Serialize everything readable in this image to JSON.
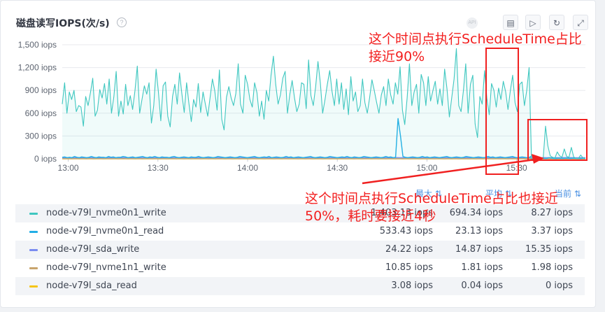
{
  "panel": {
    "title": "磁盘读写IOPS(次/s)",
    "help_icon": "?",
    "api_icon": "API",
    "toolbar": [
      {
        "name": "calendar-icon",
        "glyph": "▤"
      },
      {
        "name": "play-icon",
        "glyph": "▷"
      },
      {
        "name": "refresh-icon",
        "glyph": "↻"
      },
      {
        "name": "expand-icon",
        "glyph": "⤢"
      }
    ]
  },
  "legend": {
    "headers": {
      "max": "最大",
      "avg": "平均",
      "current": "当前"
    },
    "rows": [
      {
        "name": "node-v79l_nvme0n1_write",
        "color": "#3fc7c0",
        "max": "1,403.13 iops",
        "avg": "694.34 iops",
        "current": "8.27 iops"
      },
      {
        "name": "node-v79l_nvme0n1_read",
        "color": "#22aee6",
        "max": "533.43 iops",
        "avg": "23.13 iops",
        "current": "3.37 iops"
      },
      {
        "name": "node-v79l_sda_write",
        "color": "#7b8cf0",
        "max": "24.22 iops",
        "avg": "14.87 iops",
        "current": "15.35 iops"
      },
      {
        "name": "node-v79l_nvme1n1_write",
        "color": "#c8a46c",
        "max": "10.85 iops",
        "avg": "1.81 iops",
        "current": "1.98 iops"
      },
      {
        "name": "node-v79l_sda_read",
        "color": "#f5c518",
        "max": "3.08 iops",
        "avg": "0.04 iops",
        "current": "0 iops"
      }
    ]
  },
  "annotations": {
    "top": "这个时间点执行ScheduleTime占比接近90%",
    "bottom": "这个时间点执行ScheduleTime占比也接近50%，耗时要接近4秒"
  },
  "chart_data": {
    "type": "line",
    "x_ticks": [
      "13:00",
      "13:30",
      "14:00",
      "14:30",
      "15:00",
      "15:30"
    ],
    "x_range": [
      "12:58",
      "15:53"
    ],
    "ylim": [
      0,
      1500
    ],
    "y_ticks": [
      "0 iops",
      "300 iops",
      "600 iops",
      "900 iops",
      "1,200 iops",
      "1,500 iops"
    ],
    "grid": true,
    "series": [
      {
        "name": "node-v79l_nvme0n1_write",
        "color": "#3fc7c0",
        "area": true,
        "values": [
          720,
          1000,
          600,
          880,
          780,
          900,
          620,
          700,
          680,
          430,
          820,
          700,
          870,
          1060,
          560,
          640,
          910,
          800,
          990,
          720,
          1050,
          600,
          820,
          1150,
          560,
          760,
          590,
          980,
          700,
          830,
          650,
          900,
          1220,
          600,
          780,
          960,
          850,
          1000,
          470,
          700,
          1180,
          880,
          500,
          960,
          1010,
          560,
          420,
          820,
          980,
          720,
          1130,
          850,
          610,
          1000,
          730,
          490,
          780,
          680,
          990,
          610,
          880,
          720,
          560,
          800,
          1050,
          900,
          640,
          1170,
          520,
          380,
          810,
          950,
          800,
          700,
          860,
          1250,
          720,
          600,
          1100,
          980,
          780,
          680,
          1000,
          870,
          560,
          760,
          520,
          900,
          760,
          1100,
          1350,
          980,
          720,
          840,
          1060,
          1150,
          600,
          850,
          1030,
          800,
          620,
          720,
          1000,
          980,
          660,
          1300,
          830,
          700,
          950,
          1280,
          1000,
          600,
          780,
          980,
          1160,
          890,
          700,
          1050,
          720,
          1000,
          650,
          920,
          580,
          1080,
          760,
          880,
          620,
          700,
          1050,
          740,
          600,
          800,
          1040,
          900,
          740,
          600,
          840,
          950,
          700,
          1050,
          840,
          720,
          1000,
          850,
          1210,
          640,
          450,
          800,
          1250,
          700,
          880,
          980,
          600,
          1110,
          1000,
          700,
          1080,
          760,
          900,
          1020,
          720,
          920,
          700,
          1180,
          920,
          550,
          800,
          1050,
          1450,
          700,
          620,
          900,
          1250,
          600,
          980,
          1100,
          460,
          280,
          820,
          720,
          1160,
          800,
          580,
          990,
          900,
          680,
          930,
          780,
          1020,
          880,
          650,
          900,
          1100,
          740,
          620,
          980,
          1010,
          700,
          900,
          1200,
          0,
          0,
          0,
          0,
          0,
          0,
          430,
          170,
          40,
          20,
          10,
          90,
          40,
          20,
          130,
          30,
          20,
          150,
          25,
          5,
          5,
          50,
          10,
          8
        ]
      },
      {
        "name": "node-v79l_nvme0n1_read",
        "color": "#22aee6",
        "area": false,
        "values": [
          20,
          25,
          15,
          20,
          15,
          30,
          20,
          15,
          25,
          20,
          15,
          20,
          30,
          20,
          15,
          25,
          20,
          20,
          15,
          30,
          20,
          25,
          15,
          20,
          20,
          30,
          25,
          15,
          20,
          25,
          15,
          20,
          25,
          30,
          20,
          15,
          25,
          20,
          30,
          20,
          15,
          25,
          20,
          20,
          15,
          25,
          30,
          20,
          15,
          20,
          25,
          20,
          15,
          25,
          20,
          20,
          30,
          20,
          15,
          20,
          25,
          20,
          15,
          20,
          30,
          25,
          20,
          15,
          20,
          25,
          20,
          15,
          20,
          30,
          25,
          20,
          15,
          20,
          25,
          30,
          20,
          15,
          20,
          25,
          20,
          30,
          15,
          20,
          25,
          20,
          15,
          20,
          30,
          20,
          25,
          15,
          20,
          25,
          20,
          15,
          20,
          25,
          30,
          20,
          15,
          20,
          25,
          20,
          15,
          20,
          30,
          25,
          20,
          15,
          20,
          25,
          20,
          30,
          20,
          15,
          25,
          20,
          15,
          20,
          30,
          25,
          20,
          15,
          20,
          25,
          20,
          15,
          20,
          30,
          20,
          25,
          15,
          20,
          530,
          300,
          30,
          20,
          15,
          20,
          25,
          20,
          15,
          20,
          30,
          20,
          25,
          15,
          20,
          25,
          20,
          15,
          20,
          25,
          30,
          20,
          15,
          20,
          25,
          20,
          15,
          20,
          30,
          25,
          20,
          15,
          20,
          25,
          20,
          15,
          20,
          30,
          20,
          25,
          15,
          20,
          25,
          20,
          15,
          20,
          25,
          30,
          20,
          15,
          20,
          25,
          20,
          15,
          20,
          40,
          10,
          5,
          5,
          8,
          5,
          3,
          15,
          10,
          5,
          5,
          8,
          5,
          5,
          10,
          5,
          5,
          8,
          5,
          3,
          5,
          6,
          4
        ]
      },
      {
        "name": "node-v79l_sda_write",
        "color": "#7b8cf0",
        "area": false,
        "values": [
          15,
          14,
          16,
          15,
          14,
          15,
          16,
          14,
          15,
          15,
          14,
          16,
          15,
          14,
          15,
          16,
          15,
          14,
          15,
          16,
          15,
          14,
          15,
          15,
          16,
          14,
          15,
          16,
          15,
          14,
          15,
          15,
          16,
          14,
          15,
          16,
          15,
          14,
          15,
          15,
          16,
          14,
          15,
          16,
          15,
          14,
          15,
          15,
          16,
          14,
          15,
          16,
          15,
          14,
          15,
          15,
          16,
          14,
          15,
          16,
          15,
          14,
          15,
          15,
          16,
          14,
          15,
          16,
          15,
          14,
          15,
          15,
          16,
          14,
          15,
          16,
          15,
          14,
          15,
          15,
          16,
          14,
          15,
          16,
          15,
          14,
          15,
          15,
          16,
          14,
          15,
          16,
          15,
          14,
          15,
          15,
          16,
          14,
          15,
          16,
          15,
          14,
          15,
          15,
          16,
          14,
          15,
          16,
          15,
          14,
          15,
          15,
          16,
          14,
          15,
          16,
          15,
          14,
          15,
          15,
          16,
          14,
          15,
          16,
          15,
          14,
          15,
          15,
          16,
          14,
          15,
          16,
          15,
          14,
          15,
          15,
          16,
          14,
          15,
          16,
          15,
          14,
          15,
          15,
          16,
          14,
          15,
          16,
          15,
          14,
          15,
          15,
          16,
          14,
          15,
          16,
          15,
          14,
          15,
          15,
          16,
          14,
          15,
          16,
          15,
          14,
          15,
          15,
          16,
          14,
          15,
          16,
          15,
          14,
          15,
          15,
          16,
          14,
          15,
          16,
          15,
          14,
          15,
          15,
          16,
          14,
          15,
          16,
          15,
          14,
          15,
          15,
          16,
          14,
          15,
          16,
          15,
          14,
          15,
          15,
          16,
          14,
          15,
          16,
          15,
          14,
          15,
          15,
          16,
          14,
          15,
          16,
          15,
          14,
          15,
          15,
          16,
          15
        ]
      },
      {
        "name": "node-v79l_nvme1n1_write",
        "color": "#c8a46c",
        "area": false,
        "values": [
          2,
          1,
          2,
          2,
          1,
          2,
          3,
          1,
          2,
          2,
          1,
          2,
          2,
          1,
          2,
          3,
          2,
          1,
          2,
          2,
          1,
          2,
          2,
          1,
          2,
          3,
          2,
          1,
          2,
          2,
          1,
          2,
          2,
          1,
          2,
          3,
          2,
          1,
          2,
          2,
          1,
          2,
          2,
          1,
          2,
          3,
          2,
          1,
          2,
          2,
          1,
          2,
          2,
          1,
          2,
          3,
          2,
          1,
          2,
          2,
          1,
          2,
          2,
          1,
          2,
          3,
          2,
          1,
          2,
          2,
          1,
          2,
          2,
          1,
          2,
          3,
          2,
          1,
          2,
          2,
          1,
          2,
          2,
          1,
          2,
          3,
          2,
          1,
          2,
          2,
          1,
          2,
          2,
          1,
          2,
          3,
          2,
          1,
          2,
          2,
          1,
          2,
          2,
          1,
          2,
          3,
          2,
          1,
          2,
          2,
          1,
          2,
          2,
          1,
          2,
          3,
          2,
          1,
          2,
          2,
          1,
          2,
          2,
          1,
          2,
          3,
          2,
          1,
          2,
          2,
          1,
          2,
          2,
          1,
          2,
          3,
          2,
          1,
          2,
          2,
          1,
          2,
          2,
          1,
          2,
          3,
          2,
          1,
          2,
          2,
          1,
          2,
          2,
          1,
          2,
          3,
          2,
          1,
          2,
          2,
          1,
          2,
          2,
          1,
          2,
          3,
          2,
          1,
          2,
          2,
          1,
          2,
          2,
          1,
          2,
          3,
          2,
          1,
          2,
          2,
          1,
          2,
          2,
          1,
          2,
          3,
          2,
          1,
          2,
          2,
          1,
          2,
          2,
          1,
          2,
          3,
          2,
          1,
          2,
          2,
          1,
          2,
          2,
          1,
          2,
          3,
          2,
          1,
          2,
          2,
          1,
          2,
          2,
          1,
          2,
          2
        ]
      },
      {
        "name": "node-v79l_sda_read",
        "color": "#f5c518",
        "area": false,
        "values": [
          0,
          0,
          0,
          0,
          0,
          0,
          0,
          0,
          0,
          0,
          0,
          0,
          0,
          0,
          0,
          0,
          0,
          0,
          0,
          0,
          0,
          0,
          0,
          0,
          0,
          0,
          0,
          0,
          0,
          0,
          0,
          0,
          0,
          0,
          0,
          0,
          0,
          0,
          0,
          0,
          0,
          0,
          0,
          0,
          0,
          0,
          0,
          0,
          0,
          0,
          0,
          0,
          0,
          0,
          0,
          0,
          0,
          0,
          0,
          0,
          0,
          0,
          0,
          0,
          0,
          0,
          0,
          0,
          0,
          0,
          0,
          0,
          0,
          0,
          0,
          0,
          0,
          0,
          0,
          0,
          0,
          0,
          0,
          0,
          0,
          0,
          0,
          0,
          0,
          0,
          0,
          0,
          0,
          0,
          0,
          0,
          0,
          0,
          0,
          0,
          0,
          0,
          0,
          0,
          0,
          0,
          0,
          0,
          0,
          0,
          0,
          0,
          0,
          0,
          0,
          0,
          0,
          0,
          0,
          0,
          0,
          0,
          0,
          0,
          0,
          0,
          0,
          0,
          0,
          0,
          0,
          0,
          0,
          0,
          0,
          0,
          0,
          0,
          0,
          0,
          0,
          0,
          0,
          0,
          0,
          0,
          0,
          0,
          0,
          0,
          0,
          0,
          0,
          0,
          0,
          0,
          0,
          0,
          0,
          0,
          0,
          0,
          0,
          0,
          0,
          0,
          0,
          0,
          0,
          0,
          0,
          0,
          0,
          0,
          0,
          0,
          0,
          0,
          0,
          0,
          0,
          0,
          0,
          0,
          0,
          0,
          0,
          0,
          0,
          0,
          0,
          0,
          0,
          0,
          0,
          0,
          0,
          0,
          0,
          0,
          0,
          0,
          0,
          0,
          0,
          0,
          0,
          0,
          0,
          0,
          0,
          0,
          0,
          0,
          0,
          0,
          0,
          0,
          0,
          0,
          0,
          0,
          0,
          0,
          0,
          0,
          0,
          0,
          0,
          0
        ]
      }
    ]
  }
}
